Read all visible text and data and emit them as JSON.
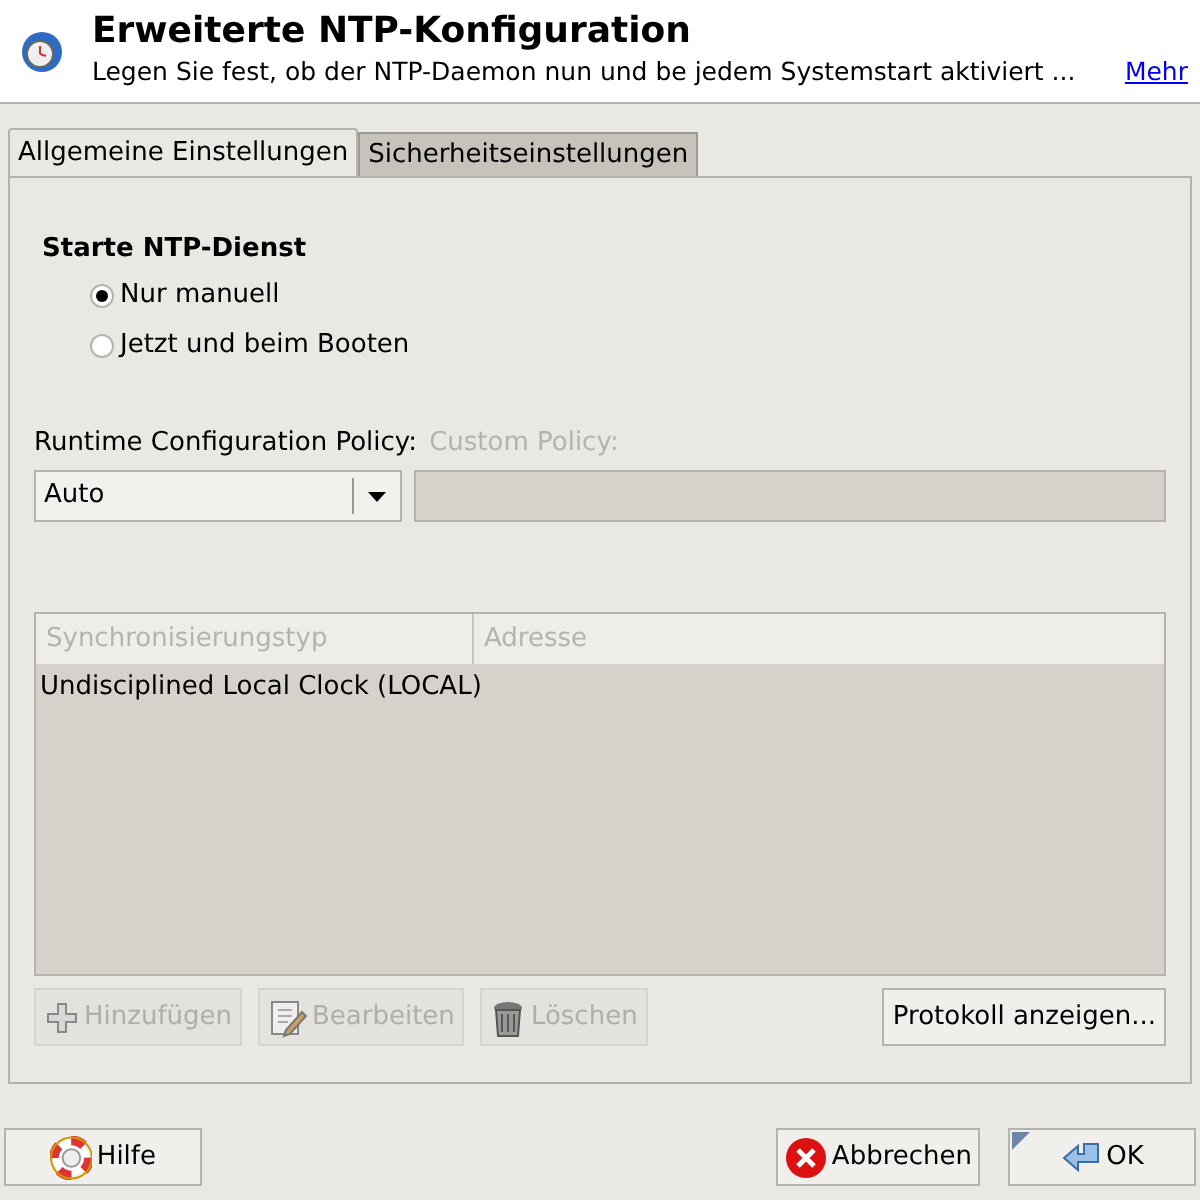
{
  "header": {
    "title": "Erweiterte NTP-Konfiguration",
    "description": "Legen Sie fest, ob der NTP-Daemon nun und be jedem Systemstart aktiviert ...",
    "link": "Mehr"
  },
  "tabs": [
    {
      "label": "Allgemeine Einstellungen",
      "selected": true
    },
    {
      "label": "Sicherheitseinstellungen",
      "selected": false
    }
  ],
  "start_group": {
    "title": "Starte NTP-Dienst",
    "options": [
      {
        "label": "Nur manuell",
        "selected": true
      },
      {
        "label": "Jetzt und beim Booten",
        "selected": false
      }
    ]
  },
  "policy": {
    "label": "Runtime Configuration Policy:",
    "value": "Auto",
    "custom_label": "Custom Policy:",
    "custom_disabled": true
  },
  "table": {
    "columns": [
      "Synchronisierungstyp",
      "Adresse"
    ],
    "rows": [
      [
        "Undisciplined Local Clock (LOCAL)",
        ""
      ]
    ]
  },
  "table_buttons": [
    {
      "kind": "add",
      "label": "Hinzufügen",
      "disabled": true
    },
    {
      "kind": "edit",
      "label": "Bearbeiten",
      "disabled": true
    },
    {
      "kind": "delete",
      "label": "Löschen",
      "disabled": true
    }
  ],
  "log_button": "Protokoll anzeigen...",
  "footer": [
    {
      "kind": "help",
      "label": "Hilfe"
    },
    {
      "kind": "cancel",
      "label": "Abbrechen"
    },
    {
      "kind": "ok",
      "label": "OK"
    }
  ]
}
